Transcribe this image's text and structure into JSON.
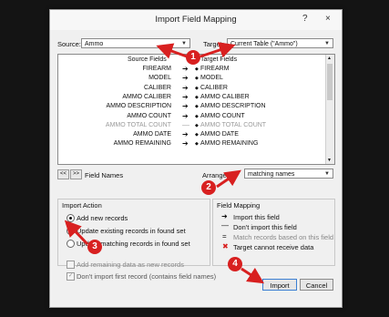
{
  "dialog": {
    "title": "Import Field Mapping",
    "help": "?",
    "close": "×"
  },
  "source": {
    "label": "Source:",
    "value": "Ammo"
  },
  "target": {
    "label": "Target:",
    "value": "Current Table (\"Ammo\")"
  },
  "list": {
    "header_source": "Source Fields",
    "header_target": "Target Fields",
    "rows": [
      {
        "src": "FIREARM",
        "tgt": "FIREARM"
      },
      {
        "src": "MODEL",
        "tgt": "MODEL"
      },
      {
        "src": "CALIBER",
        "tgt": "CALIBER"
      },
      {
        "src": "AMMO CALIBER",
        "tgt": "AMMO CALIBER"
      },
      {
        "src": "AMMO DESCRIPTION",
        "tgt": "AMMO DESCRIPTION"
      },
      {
        "src": "AMMO COUNT",
        "tgt": "AMMO COUNT"
      },
      {
        "src": "AMMO TOTAL COUNT",
        "tgt": "AMMO TOTAL COUNT"
      },
      {
        "src": "AMMO DATE",
        "tgt": "AMMO DATE"
      },
      {
        "src": "AMMO REMAINING",
        "tgt": "AMMO REMAINING"
      }
    ]
  },
  "nav": {
    "prev": "<<",
    "next": ">>",
    "label": "Field Names"
  },
  "arrange": {
    "label": "Arrange by:",
    "value": "matching names"
  },
  "import_action": {
    "title": "Import Action",
    "options": [
      "Add new records",
      "Update existing records in found set",
      "Update matching records in found set"
    ],
    "add_remaining": "Add remaining data as new records",
    "dont_import_first": "Don't import first record (contains field names)"
  },
  "field_mapping": {
    "title": "Field Mapping",
    "items": [
      "Import this field",
      "Don't import this field",
      "Match records based on this field",
      "Target cannot receive data"
    ]
  },
  "buttons": {
    "import": "Import",
    "cancel": "Cancel"
  },
  "annotations": [
    "1",
    "2",
    "3",
    "4"
  ],
  "colors": {
    "annotation": "#d82020",
    "default_button_border": "#3c7fd2"
  }
}
